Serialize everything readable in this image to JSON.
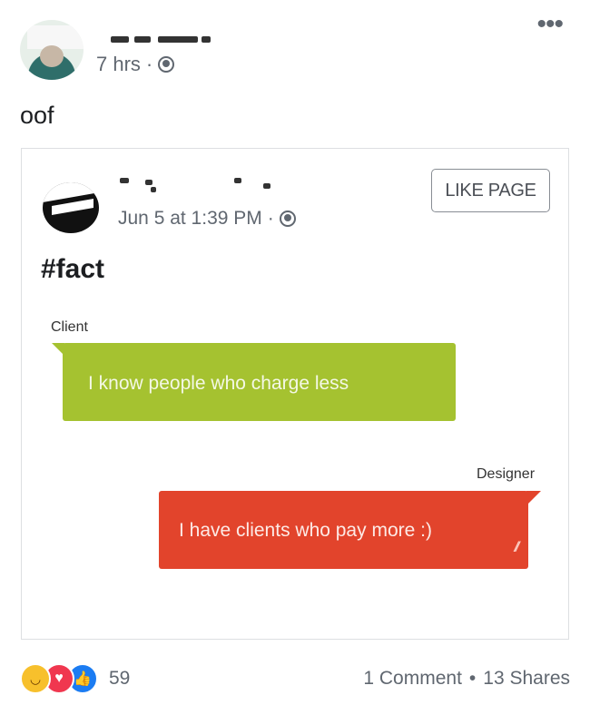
{
  "post": {
    "time": "7 hrs",
    "text": "oof",
    "more_icon": "more-dots-icon",
    "privacy_icon": "globe-icon"
  },
  "shared": {
    "timestamp": "Jun 5 at 1:39 PM",
    "like_page_label": "LIKE PAGE",
    "hashtag": "#fact",
    "chat": {
      "client_label": "Client",
      "client_message": "I know people who charge less",
      "designer_label": "Designer",
      "designer_message": "I have clients who pay more :)",
      "colors": {
        "client_bubble": "#a5c230",
        "designer_bubble": "#e2442c"
      }
    }
  },
  "footer": {
    "reaction_icons": [
      "haha-icon",
      "love-icon",
      "like-icon"
    ],
    "reaction_count": "59",
    "comments": "1 Comment",
    "separator": "•",
    "shares": "13 Shares"
  }
}
